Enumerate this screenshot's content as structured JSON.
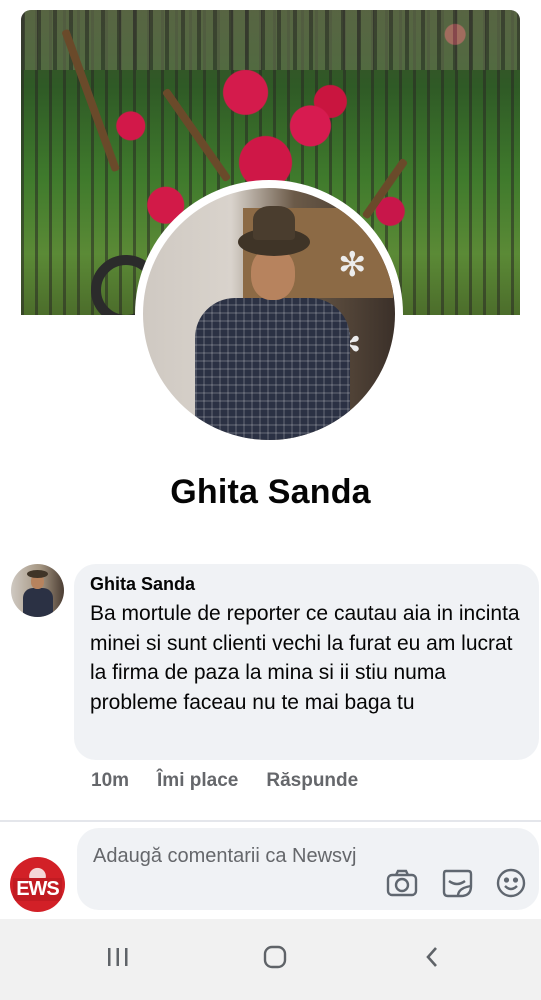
{
  "profile": {
    "name": "Ghita Sanda"
  },
  "comment": {
    "author": "Ghita Sanda",
    "text": "Ba mortule de reporter ce cautau aia in incinta minei si sunt clienti vechi la furat eu am lucrat la firma de paza la mina si ii stiu numa probleme faceau nu te mai baga tu",
    "time": "10m",
    "like_label": "Îmi place",
    "reply_label": "Răspunde"
  },
  "composer": {
    "placeholder": "Adaugă comentarii ca Newsvj",
    "avatar_logo": "EWS",
    "icons": [
      "camera-icon",
      "gif-sticker-icon",
      "emoji-icon"
    ]
  },
  "system_nav": {
    "icons": [
      "recent-apps-icon",
      "home-icon",
      "back-icon"
    ]
  },
  "colors": {
    "bubble": "#f0f2f5",
    "meta_text": "#65676b",
    "nav_bg": "#f1f1f1"
  }
}
